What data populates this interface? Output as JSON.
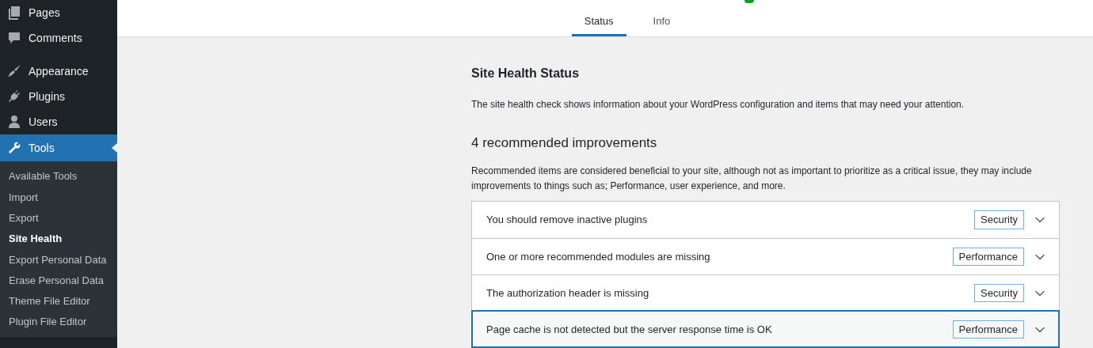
{
  "sidebar": {
    "items": [
      {
        "label": "Pages",
        "selected": false
      },
      {
        "label": "Comments",
        "selected": false
      },
      {
        "label": "Appearance",
        "selected": false
      },
      {
        "label": "Plugins",
        "selected": false
      },
      {
        "label": "Users",
        "selected": false
      },
      {
        "label": "Tools",
        "selected": true
      }
    ],
    "submenu": [
      {
        "label": "Available Tools",
        "selected": false
      },
      {
        "label": "Import",
        "selected": false
      },
      {
        "label": "Export",
        "selected": false
      },
      {
        "label": "Site Health",
        "selected": true
      },
      {
        "label": "Export Personal Data",
        "selected": false
      },
      {
        "label": "Erase Personal Data",
        "selected": false
      },
      {
        "label": "Theme File Editor",
        "selected": false
      },
      {
        "label": "Plugin File Editor",
        "selected": false
      }
    ]
  },
  "tabs": [
    {
      "label": "Status",
      "selected": true
    },
    {
      "label": "Info",
      "selected": false
    }
  ],
  "content": {
    "title": "Site Health Status",
    "intro": "The site health check shows information about your WordPress configuration and items that may need your attention.",
    "heading": "4 recommended improvements",
    "description": "Recommended items are considered beneficial to your site, although not as important to prioritize as a critical issue, they may include improvements to things such as; Performance, user experience, and more.",
    "issues": [
      {
        "title": "You should remove inactive plugins",
        "badge": "Security",
        "focused": false
      },
      {
        "title": "One or more recommended modules are missing",
        "badge": "Performance",
        "focused": false
      },
      {
        "title": "The authorization header is missing",
        "badge": "Security",
        "focused": false
      },
      {
        "title": "Page cache is not detected but the server response time is OK",
        "badge": "Performance",
        "focused": true
      }
    ]
  }
}
